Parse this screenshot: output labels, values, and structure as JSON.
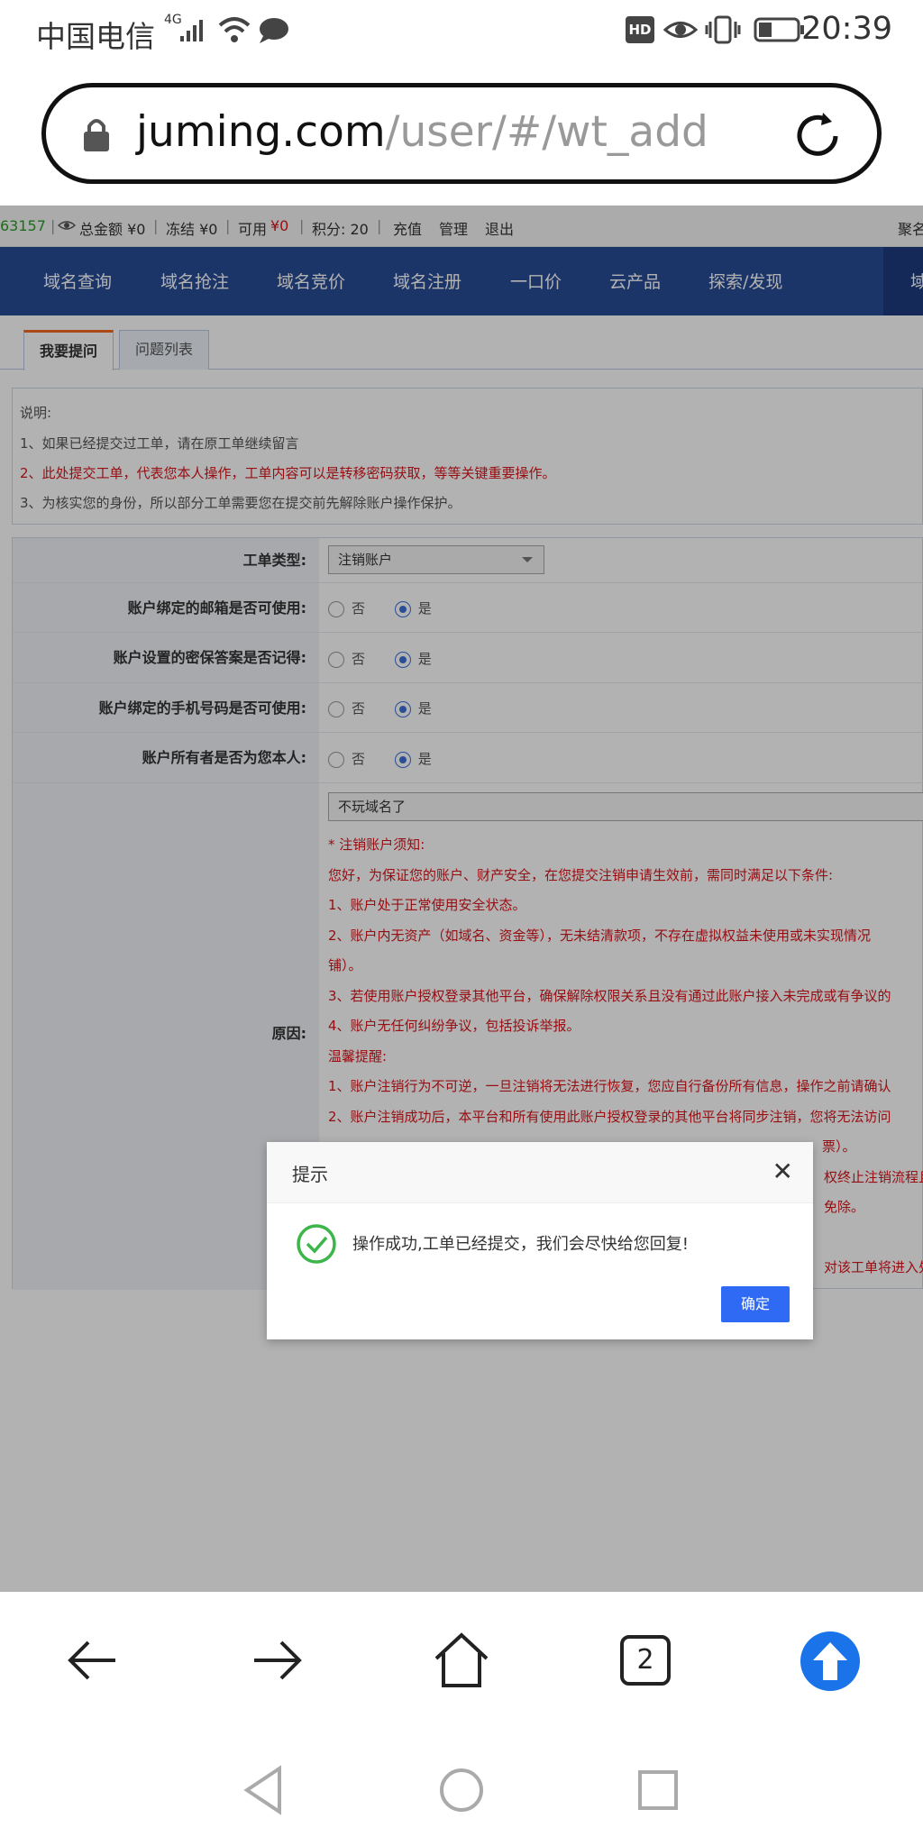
{
  "status_bar": {
    "carrier": "中国电信",
    "network": "4G",
    "time": "20:39",
    "hd_badge": "HD"
  },
  "browser": {
    "url_host": "juming.com",
    "url_path": "/user/#/wt_add",
    "tab_count": "2"
  },
  "account_bar": {
    "id": "63157",
    "total_balance": "总金额 ¥0",
    "frozen": "冻结 ¥0",
    "available_label": "可用",
    "available_value": "¥0",
    "points": "积分: 20",
    "recharge": "充值",
    "manage": "管理",
    "logout": "退出",
    "right_text": "聚名"
  },
  "nav": {
    "items": [
      "域名查询",
      "域名抢注",
      "域名竞价",
      "域名注册",
      "一口价",
      "云产品",
      "探索/发现",
      "域"
    ]
  },
  "tabs": [
    "我要提问",
    "问题列表"
  ],
  "notes": {
    "title": "说明:",
    "line1": "1、如果已经提交过工单，请在原工单继续留言",
    "line2": "2、此处提交工单，代表您本人操作，工单内容可以是转移密码获取，等等关键重要操作。",
    "line3": "3、为核实您的身份，所以部分工单需要您在提交前先解除账户操作保护。"
  },
  "form": {
    "type_label": "工单类型:",
    "type_value": "注销账户",
    "q1_label": "账户绑定的邮箱是否可使用:",
    "q2_label": "账户设置的密保答案是否记得:",
    "q3_label": "账户绑定的手机号码是否可使用:",
    "q4_label": "账户所有者是否为您本人:",
    "opt_no": "否",
    "opt_yes": "是",
    "reason_label": "原因:",
    "reason_value": "不玩域名了",
    "notice": [
      "* 注销账户须知:",
      "您好，为保证您的账户、财产安全，在您提交注销申请生效前，需同时满足以下条件:",
      "1、账户处于正常使用安全状态。",
      "2、账户内无资产（如域名、资金等），无未结清款项，不存在虚拟权益未使用或未实现情况",
      "铺）。",
      "3、若使用账户授权登录其他平台，确保解除权限关系且没有通过此账户接入未完成或有争议的",
      "4、账户无任何纠纷争议，包括投诉举报。",
      "温馨提醒:",
      "1、账户注销行为不可逆，一旦注销将无法进行恢复，您应自行备份所有信息，操作之前请确认",
      "2、账户注销成功后，本平台和所有使用此账户授权登录的其他平台将同步注销，您将无法访问",
      "票）。",
      "权终止注销流程且",
      "免除。",
      "",
      "对该工单将进入处"
    ]
  },
  "dialog": {
    "title": "提示",
    "message": "操作成功,工单已经提交，我们会尽快给您回复!",
    "confirm": "确定"
  }
}
